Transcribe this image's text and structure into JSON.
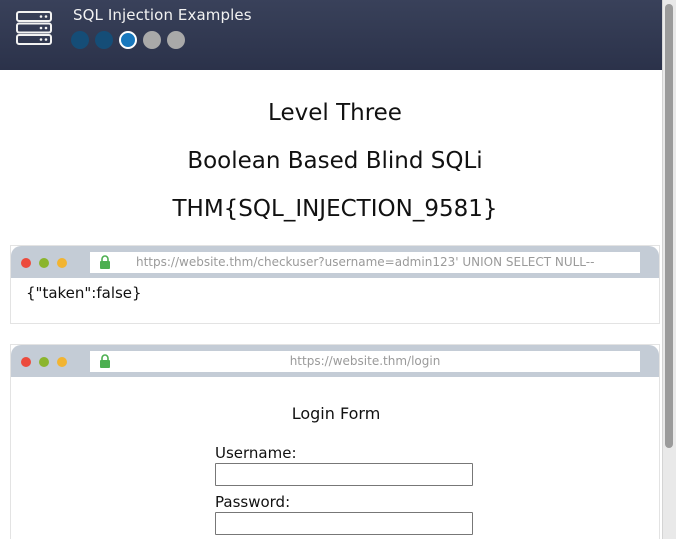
{
  "header": {
    "title": "SQL Injection Examples",
    "progress": {
      "total": 5,
      "completed": 2,
      "current_index": 3
    },
    "colors": {
      "background": "#2f3650",
      "done": "#154d77",
      "current": "#1978bd",
      "todo": "#a9a9a9"
    }
  },
  "level": {
    "name": "Level Three",
    "technique": "Boolean Based Blind SQLi",
    "flag": "THM{SQL_INJECTION_9581}"
  },
  "browser1": {
    "url": "https://website.thm/checkuser?username=admin123' UNION SELECT NULL--",
    "response": "{\"taken\":false}"
  },
  "browser2": {
    "url": "https://website.thm/login",
    "form_title": "Login Form",
    "username_label": "Username:",
    "password_label": "Password:",
    "username_value": "",
    "password_value": ""
  },
  "icons": {
    "header": "server-rack-icon",
    "lock": "lock-icon"
  }
}
